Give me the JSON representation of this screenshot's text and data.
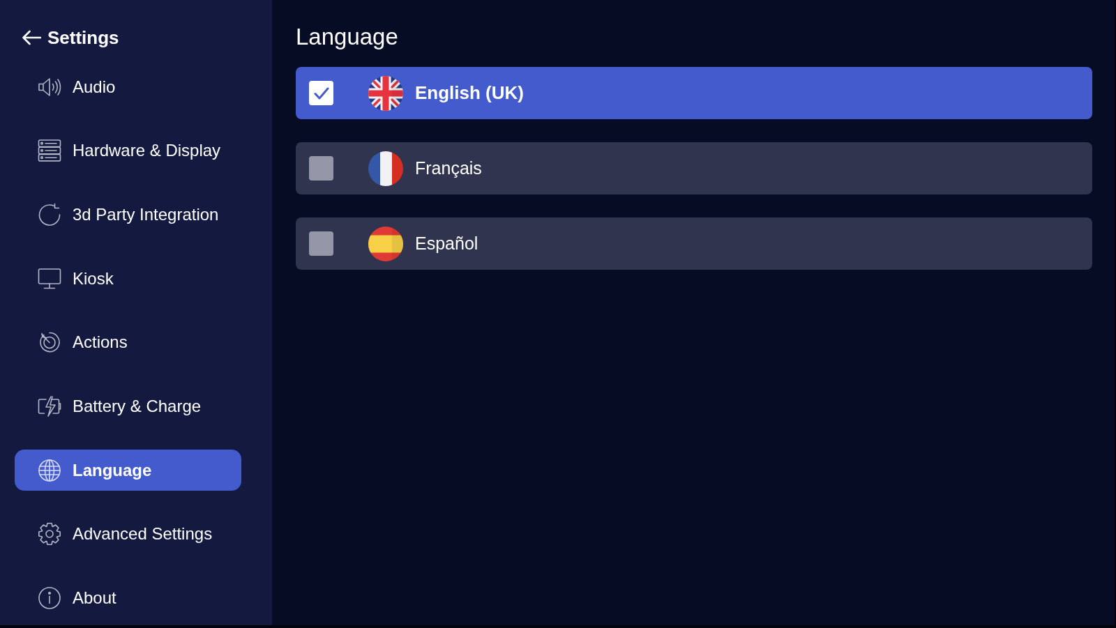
{
  "sidebar": {
    "title": "Settings",
    "items": [
      {
        "label": "Audio",
        "kind": "audio",
        "selected": false
      },
      {
        "label": "Hardware & Display",
        "kind": "hardware",
        "selected": false
      },
      {
        "label": "3d Party Integration",
        "kind": "integration",
        "selected": false
      },
      {
        "label": "Kiosk",
        "kind": "kiosk",
        "selected": false
      },
      {
        "label": "Actions",
        "kind": "actions",
        "selected": false
      },
      {
        "label": "Battery & Charge",
        "kind": "battery",
        "selected": false
      },
      {
        "label": "Language",
        "kind": "language",
        "selected": true
      },
      {
        "label": "Advanced Settings",
        "kind": "advanced",
        "selected": false
      },
      {
        "label": "About",
        "kind": "about",
        "selected": false
      }
    ]
  },
  "main": {
    "title": "Language",
    "languages": [
      {
        "label": "English (UK)",
        "kind": "uk",
        "selected": true
      },
      {
        "label": "Français",
        "kind": "fr",
        "selected": false
      },
      {
        "label": "Español",
        "kind": "es",
        "selected": false
      }
    ]
  }
}
